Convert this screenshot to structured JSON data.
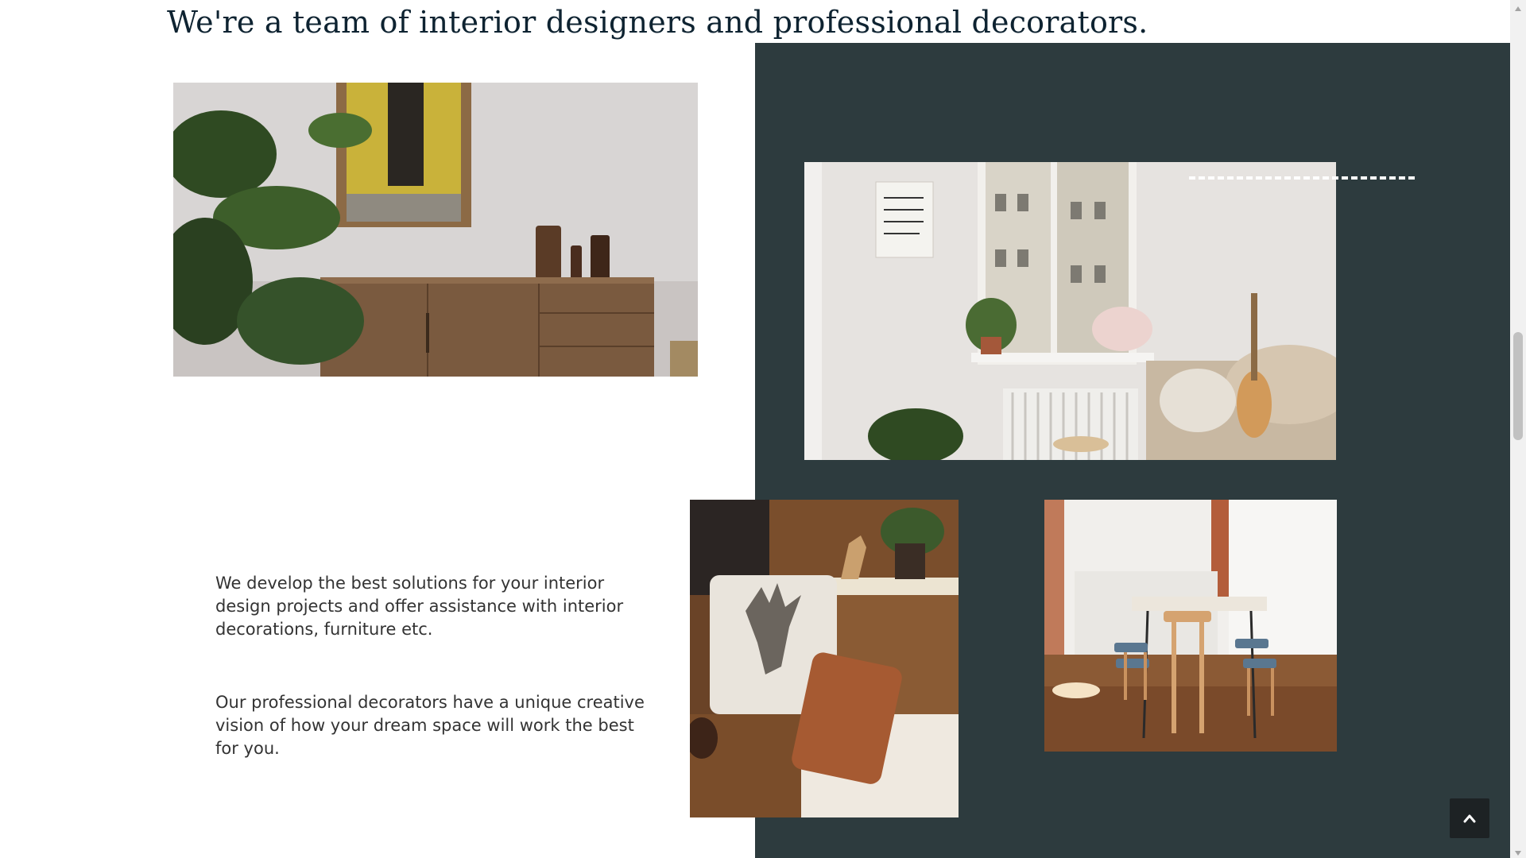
{
  "section": {
    "heading": "We're a team of interior designers and professional decorators.",
    "paragraphs": [
      "We develop the best solutions for your interior design projects and offer assistance with interior decorations, furniture etc.",
      "Our professional decorators have a unique creative vision of how your dream space will work the best for you."
    ]
  },
  "images": {
    "sideboard": "sideboard-with-plants-photo",
    "window": "living-room-window-photo",
    "cushions": "deer-cushion-sofa-photo",
    "dining": "dining-table-photo"
  },
  "colors": {
    "panel": "#2d3b3e",
    "heading": "#0e2331",
    "text": "#333333",
    "scroll_button": "#1d2224"
  },
  "icons": {
    "scroll_top": "chevron-up-icon",
    "scrollbar_up": "triangle-up-icon",
    "scrollbar_down": "triangle-down-icon"
  }
}
